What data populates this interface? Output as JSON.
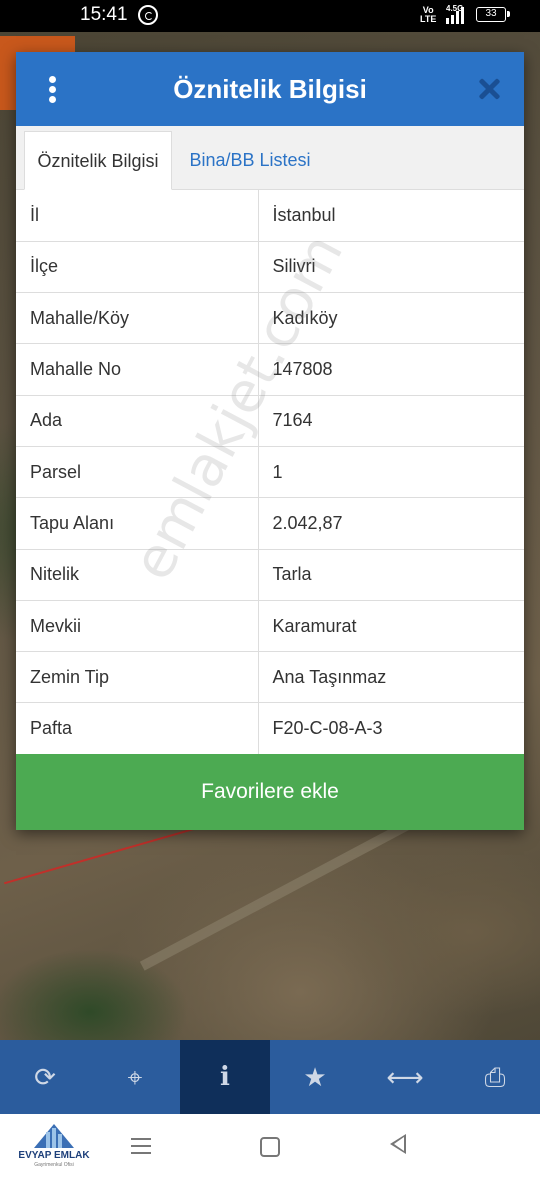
{
  "status_bar": {
    "time": "15:41",
    "volte": "Vo\nLTE",
    "network": "4.5G",
    "battery": "33"
  },
  "dialog": {
    "title": "Öznitelik Bilgisi",
    "tabs": [
      {
        "label": "Öznitelik Bilgisi",
        "active": true
      },
      {
        "label": "Bina/BB Listesi",
        "active": false
      }
    ],
    "rows": [
      {
        "key": "İl",
        "value": "İstanbul"
      },
      {
        "key": "İlçe",
        "value": "Silivri"
      },
      {
        "key": "Mahalle/Köy",
        "value": "Kadıköy"
      },
      {
        "key": "Mahalle No",
        "value": "147808"
      },
      {
        "key": "Ada",
        "value": "7164"
      },
      {
        "key": "Parsel",
        "value": "1"
      },
      {
        "key": "Tapu Alanı",
        "value": "2.042,87"
      },
      {
        "key": "Nitelik",
        "value": "Tarla"
      },
      {
        "key": "Mevkii",
        "value": "Karamurat"
      },
      {
        "key": "Zemin Tip",
        "value": "Ana Taşınmaz"
      },
      {
        "key": "Pafta",
        "value": "F20-C-08-A-3"
      }
    ],
    "favorite_button": "Favorilere ekle"
  },
  "watermark": "emlakjet.com",
  "toolbar": {
    "items": [
      {
        "icon": "refresh-icon",
        "glyph": "⟳",
        "active": false
      },
      {
        "icon": "locate-icon",
        "glyph": "⌖",
        "active": false
      },
      {
        "icon": "info-icon",
        "glyph": "i",
        "active": true
      },
      {
        "icon": "star-icon",
        "glyph": "★",
        "active": false
      },
      {
        "icon": "measure-icon",
        "glyph": "⟷",
        "active": false
      },
      {
        "icon": "print-icon",
        "glyph": "⎙",
        "active": false
      }
    ]
  },
  "logo": {
    "brand": "EVYAP EMLAK",
    "sub": "Gayrimenkul Ofisi"
  },
  "colors": {
    "header": "#2b73c6",
    "toolbar": "#2b5c9d",
    "toolbar_active": "#0f2f5a",
    "favorite": "#4caa52",
    "tab_link": "#2b73c6"
  }
}
